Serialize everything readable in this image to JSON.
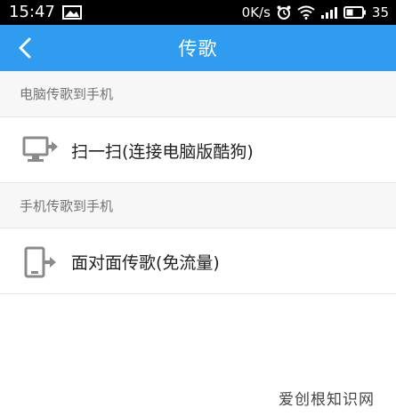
{
  "status_bar": {
    "time": "15:47",
    "network_speed": "0K/s",
    "battery_level": "35"
  },
  "nav": {
    "title": "传歌"
  },
  "sections": [
    {
      "header": "电脑传歌到手机",
      "item": {
        "label": "扫一扫(连接电脑版酷狗)",
        "icon": "monitor-transfer-icon"
      }
    },
    {
      "header": "手机传歌到手机",
      "item": {
        "label": "面对面传歌(免流量)",
        "icon": "phone-transfer-icon"
      }
    }
  ],
  "watermark": "爱创根知识网",
  "colors": {
    "nav_bar": "#2f9cf0",
    "section_background": "#f7f7f7",
    "status_bar": "#000000"
  }
}
